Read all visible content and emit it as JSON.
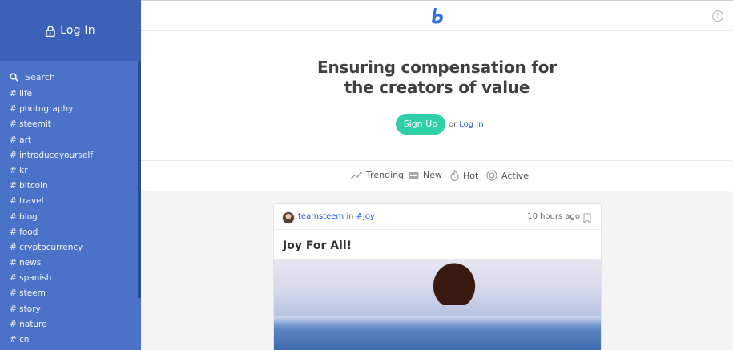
{
  "sidebar": {
    "login_label": "Log In",
    "search_placeholder": "Search",
    "tags": [
      "# life",
      "# photography",
      "# steemit",
      "# art",
      "# introduceyourself",
      "# kr",
      "# bitcoin",
      "# travel",
      "# blog",
      "# food",
      "# cryptocurrency",
      "# news",
      "# spanish",
      "# steem",
      "# story",
      "# nature",
      "# cn"
    ]
  },
  "header": {
    "brand_icon": "busy-logo-icon",
    "help_label": "?"
  },
  "hero": {
    "title_line1": "Ensuring compensation for",
    "title_line2": "the creators of value",
    "signup_label": "Sign Up",
    "or_text": "or",
    "login_label": "Log In"
  },
  "sort": {
    "items": [
      {
        "label": "Trending",
        "icon": "trending-icon"
      },
      {
        "label": "New",
        "icon": "new-icon"
      },
      {
        "label": "Hot",
        "icon": "flame-icon"
      },
      {
        "label": "Active",
        "icon": "active-icon"
      }
    ]
  },
  "post": {
    "author": "teamsteem",
    "in_text": "in",
    "tag": "#joy",
    "time": "10 hours ago",
    "title": "Joy For All!"
  },
  "colors": {
    "sidebar": "#4a72c8",
    "sidebar_header": "#3b62b8",
    "accent_green": "#2fd0a8",
    "link_blue": "#1a5ad8"
  }
}
